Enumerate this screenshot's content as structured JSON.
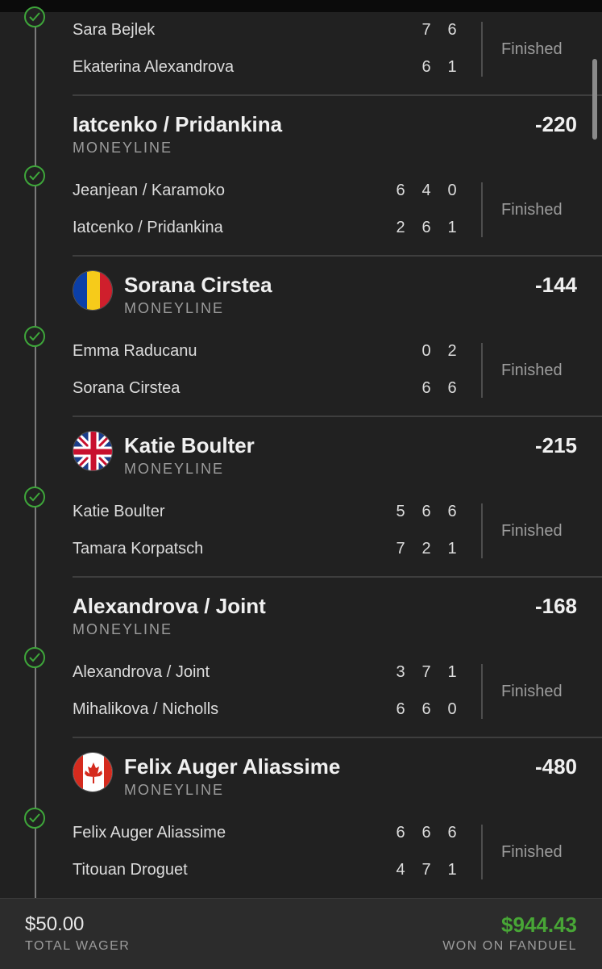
{
  "legs": [
    {
      "title": null,
      "subtitle": null,
      "odds": null,
      "flag": null,
      "teams": [
        {
          "name": "Sara Bejlek",
          "scores": [
            "7",
            "6"
          ]
        },
        {
          "name": "Ekaterina Alexandrova",
          "scores": [
            "6",
            "1"
          ]
        }
      ],
      "status": "Finished"
    },
    {
      "title": "Iatcenko / Pridankina",
      "subtitle": "MONEYLINE",
      "odds": "-220",
      "flag": null,
      "teams": [
        {
          "name": "Jeanjean / Karamoko",
          "scores": [
            "6",
            "4",
            "0"
          ]
        },
        {
          "name": "Iatcenko / Pridankina",
          "scores": [
            "2",
            "6",
            "1"
          ]
        }
      ],
      "status": "Finished"
    },
    {
      "title": "Sorana Cirstea",
      "subtitle": "MONEYLINE",
      "odds": "-144",
      "flag": "romania-flag-icon",
      "teams": [
        {
          "name": "Emma Raducanu",
          "scores": [
            "0",
            "2"
          ]
        },
        {
          "name": "Sorana Cirstea",
          "scores": [
            "6",
            "6"
          ]
        }
      ],
      "status": "Finished"
    },
    {
      "title": "Katie Boulter",
      "subtitle": "MONEYLINE",
      "odds": "-215",
      "flag": "uk-flag-icon",
      "teams": [
        {
          "name": "Katie Boulter",
          "scores": [
            "5",
            "6",
            "6"
          ]
        },
        {
          "name": "Tamara Korpatsch",
          "scores": [
            "7",
            "2",
            "1"
          ]
        }
      ],
      "status": "Finished"
    },
    {
      "title": "Alexandrova / Joint",
      "subtitle": "MONEYLINE",
      "odds": "-168",
      "flag": null,
      "teams": [
        {
          "name": "Alexandrova / Joint",
          "scores": [
            "3",
            "7",
            "1"
          ]
        },
        {
          "name": "Mihalikova / Nicholls",
          "scores": [
            "6",
            "6",
            "0"
          ]
        }
      ],
      "status": "Finished"
    },
    {
      "title": "Felix Auger Aliassime",
      "subtitle": "MONEYLINE",
      "odds": "-480",
      "flag": "canada-flag-icon",
      "teams": [
        {
          "name": "Felix Auger Aliassime",
          "scores": [
            "6",
            "6",
            "6"
          ]
        },
        {
          "name": "Titouan Droguet",
          "scores": [
            "4",
            "7",
            "1"
          ]
        }
      ],
      "status": "Finished"
    }
  ],
  "footer": {
    "wager_amount": "$50.00",
    "wager_label": "TOTAL WAGER",
    "won_amount": "$944.43",
    "won_label": "WON ON FANDUEL"
  },
  "colors": {
    "background": "#212121",
    "check": "#3ea63a",
    "won": "#48a636",
    "muted": "#9c9c9c"
  }
}
